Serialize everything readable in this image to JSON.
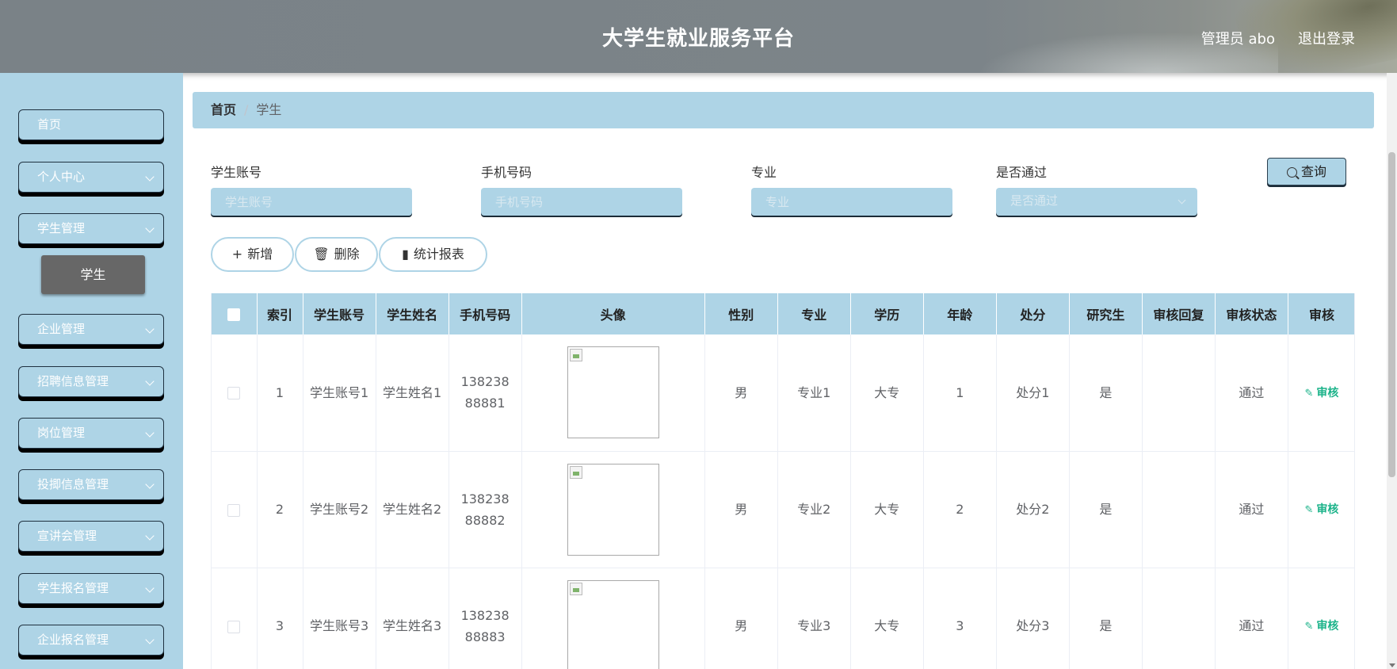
{
  "header": {
    "title": "大学生就业服务平台",
    "user": "管理员 abo",
    "logout": "退出登录"
  },
  "sidebar": {
    "items": [
      {
        "label": "首页"
      },
      {
        "label": "个人中心"
      },
      {
        "label": "学生管理"
      },
      {
        "label": "企业管理"
      },
      {
        "label": "招聘信息管理"
      },
      {
        "label": "岗位管理"
      },
      {
        "label": "投揤信息管理"
      },
      {
        "label": "宣讲会管理"
      },
      {
        "label": "学生报名管理"
      },
      {
        "label": "企业报名管理"
      }
    ],
    "sub_item": "学生"
  },
  "breadcrumb": {
    "home": "首页",
    "sep": "/",
    "current": "学生"
  },
  "search": {
    "account_label": "学生账号",
    "account_placeholder": "学生账号",
    "phone_label": "手机号码",
    "phone_placeholder": "手机号码",
    "major_label": "专业",
    "major_placeholder": "专业",
    "pass_label": "是否通过",
    "pass_placeholder": "是否通过",
    "query_button": "查询"
  },
  "actions": {
    "add": "新增",
    "delete": "删除",
    "report": "统计报表"
  },
  "table": {
    "headers": [
      "索引",
      "学生账号",
      "学生姓名",
      "手机号码",
      "头像",
      "性别",
      "专业",
      "学历",
      "年龄",
      "处分",
      "研究生",
      "审核回复",
      "审核状态",
      "审核"
    ],
    "rows": [
      {
        "index": "1",
        "account": "学生账号1",
        "name": "学生姓名1",
        "phone": "13823888881",
        "gender": "男",
        "major": "专业1",
        "edu": "大专",
        "age": "1",
        "punish": "处分1",
        "grad": "是",
        "reply": "",
        "status": "通过",
        "action": "审核"
      },
      {
        "index": "2",
        "account": "学生账号2",
        "name": "学生姓名2",
        "phone": "13823888882",
        "gender": "男",
        "major": "专业2",
        "edu": "大专",
        "age": "2",
        "punish": "处分2",
        "grad": "是",
        "reply": "",
        "status": "通过",
        "action": "审核"
      },
      {
        "index": "3",
        "account": "学生账号3",
        "name": "学生姓名3",
        "phone": "13823888883",
        "gender": "男",
        "major": "专业3",
        "edu": "大专",
        "age": "3",
        "punish": "处分3",
        "grad": "是",
        "reply": "",
        "status": "通过",
        "action": "审核"
      }
    ]
  }
}
